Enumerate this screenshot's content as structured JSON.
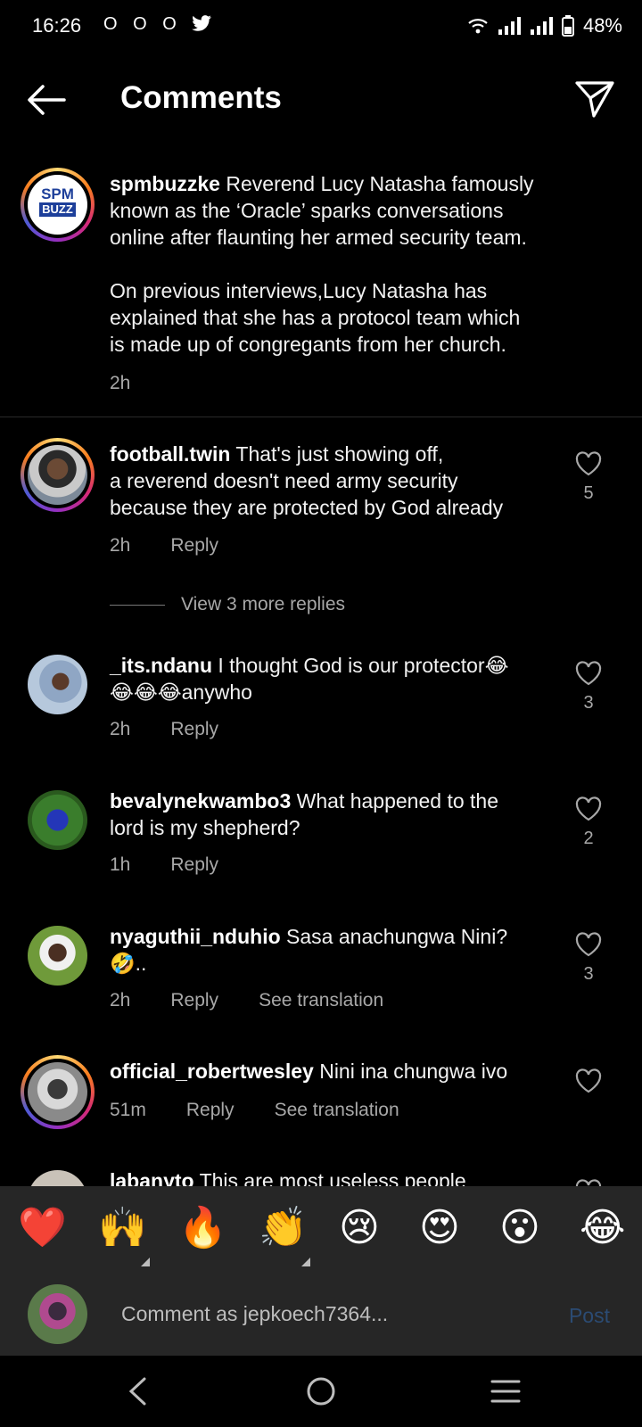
{
  "status": {
    "time": "16:26",
    "notif_icons": "O O O",
    "battery": "48%"
  },
  "header": {
    "title": "Comments",
    "back_icon": "arrow-left-icon",
    "share_icon": "paper-plane-icon"
  },
  "caption": {
    "username": "spmbuzzke",
    "avatar_text_top": "SPM",
    "avatar_text_bottom": "BUZZ",
    "text_line1": "Reverend Lucy Natasha famously",
    "text_line2": "known as the ‘Oracle’ sparks conversations",
    "text_line3": "online after flaunting her armed security team.",
    "text_line4": "On previous interviews,Lucy Natasha has",
    "text_line5": "explained that she has a protocol team which",
    "text_line6": "is made up of congregants from her church.",
    "time": "2h"
  },
  "comments": [
    {
      "username": "football.twin",
      "line1": "That's just showing off,",
      "line2": "a reverend doesn't need army security",
      "line3": "because they are protected by God already",
      "time": "2h",
      "reply": "Reply",
      "likes": "5"
    },
    {
      "username": "_its.ndanu",
      "line1": "I thought God is our protector😂",
      "line2": "😂😂😂anywho",
      "time": "2h",
      "reply": "Reply",
      "likes": "3"
    },
    {
      "username": "bevalynekwambo3",
      "line1": "What happened to the",
      "line2": "lord is my shepherd?",
      "time": "1h",
      "reply": "Reply",
      "likes": "2"
    },
    {
      "username": "nyaguthii_nduhio",
      "line1": "Sasa anachungwa Nini?",
      "line2": "🤣..",
      "time": "2h",
      "reply": "Reply",
      "translate": "See translation",
      "likes": "3"
    },
    {
      "username": "official_robertwesley",
      "line1": "Nini ina chungwa ivo",
      "time": "51m",
      "reply": "Reply",
      "translate": "See translation"
    },
    {
      "username": "labanyto",
      "line1": "This are most useless people"
    }
  ],
  "view_more": "View 3 more replies",
  "emoji_bar": [
    "❤️",
    "🙌",
    "🔥",
    "👏",
    "😢",
    "😍",
    "😮",
    "😂"
  ],
  "comment_input": {
    "placeholder": "Comment as jepkoech7364...",
    "post_label": "Post"
  },
  "colors": {
    "background": "#000000",
    "secondary_text": "#a8a8a8",
    "post_disabled": "#2b4b73",
    "bar": "#262626"
  }
}
